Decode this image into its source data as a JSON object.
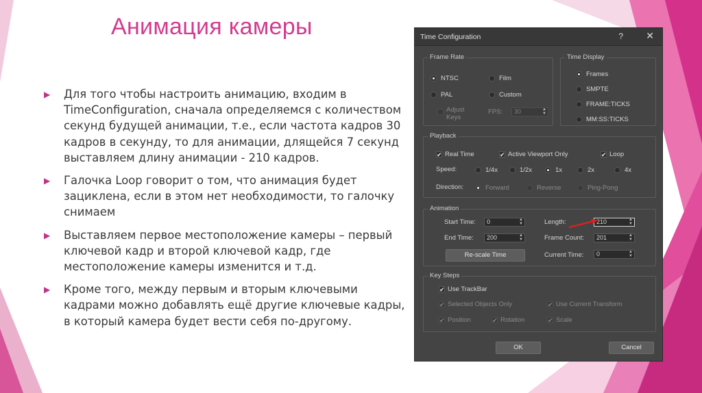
{
  "slide": {
    "title": "Анимация камеры",
    "bullets": [
      "Для того чтобы настроить  анимацию, входим в TimeConfiguration, сначала определяемся с количеством секунд будущей анимации, т.е., если частота кадров 30 кадров в секунду, то для анимации, длящейся 7 секунд выставляем длину анимации  - 210 кадров.",
      "Галочка Loop говорит о том, что анимация будет зациклена, если в этом нет необходимости, то галочку снимаем",
      "Выставляем первое местоположение камеры – первый ключевой кадр и второй ключевой кадр, где местоположение камеры изменится и т.д.",
      "Кроме того, между первым и вторым ключевыми кадрами можно добавлять ещё другие ключевые кадры, в который камера будет вести себя по-другому."
    ],
    "bullet_icon": "triangle-bullet-icon",
    "colors": {
      "title": "#d33a8f",
      "accent": "#c23386",
      "text": "#3a3a3a"
    }
  },
  "dialog": {
    "title": "Time Configuration",
    "help_symbol": "?",
    "close_symbol": "✕",
    "frame_rate": {
      "label": "Frame Rate",
      "options": [
        "NTSC",
        "Film",
        "PAL",
        "Custom"
      ],
      "selected": "NTSC",
      "adjust_keys_line1": "Adjust",
      "adjust_keys_line2": "Keys",
      "fps_label": "FPS:",
      "fps_value": "30"
    },
    "time_display": {
      "label": "Time Display",
      "options": [
        "Frames",
        "SMPTE",
        "FRAME:TICKS",
        "MM:SS:TICKS"
      ],
      "selected": "Frames"
    },
    "playback": {
      "label": "Playback",
      "real_time": "Real Time",
      "active_viewport": "Active Viewport Only",
      "loop": "Loop",
      "speed_label": "Speed:",
      "speeds": [
        "1/4x",
        "1/2x",
        "1x",
        "2x",
        "4x"
      ],
      "speed_selected": "1x",
      "direction_label": "Direction:",
      "directions": [
        "Forward",
        "Reverse",
        "Ping-Pong"
      ]
    },
    "animation": {
      "label": "Animation",
      "start_time_label": "Start Time:",
      "start_time": "0",
      "end_time_label": "End Time:",
      "end_time": "200",
      "length_label": "Length:",
      "length": "210",
      "frame_count_label": "Frame Count:",
      "frame_count": "201",
      "current_time_label": "Current Time:",
      "current_time": "0",
      "rescale_button": "Re-scale Time"
    },
    "key_steps": {
      "label": "Key Steps",
      "use_trackbar": "Use TrackBar",
      "selected_only": "Selected Objects Only",
      "use_current_transform": "Use Current Transform",
      "position": "Position",
      "rotation": "Rotation",
      "scale": "Scale"
    },
    "ok_button": "OK",
    "cancel_button": "Cancel",
    "colors": {
      "bg": "#444444",
      "annotation_arrow": "#e02020"
    }
  }
}
